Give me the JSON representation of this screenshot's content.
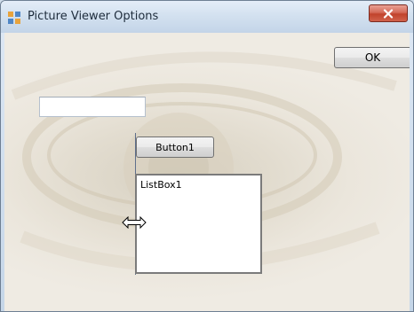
{
  "window": {
    "title": "Picture Viewer Options",
    "close_icon": "close-icon"
  },
  "form": {
    "ok_label": "OK",
    "textbox_value": "",
    "button1_label": "Button1",
    "listbox_label": "ListBox1"
  },
  "cursor": {
    "icon": "horizontal-resize-cursor-icon"
  },
  "colors": {
    "title_text": "#1e2c3c",
    "close_button": "#c1432c",
    "listbox_border": "#7b7b7b",
    "guide_line": "#5f6f8c"
  }
}
